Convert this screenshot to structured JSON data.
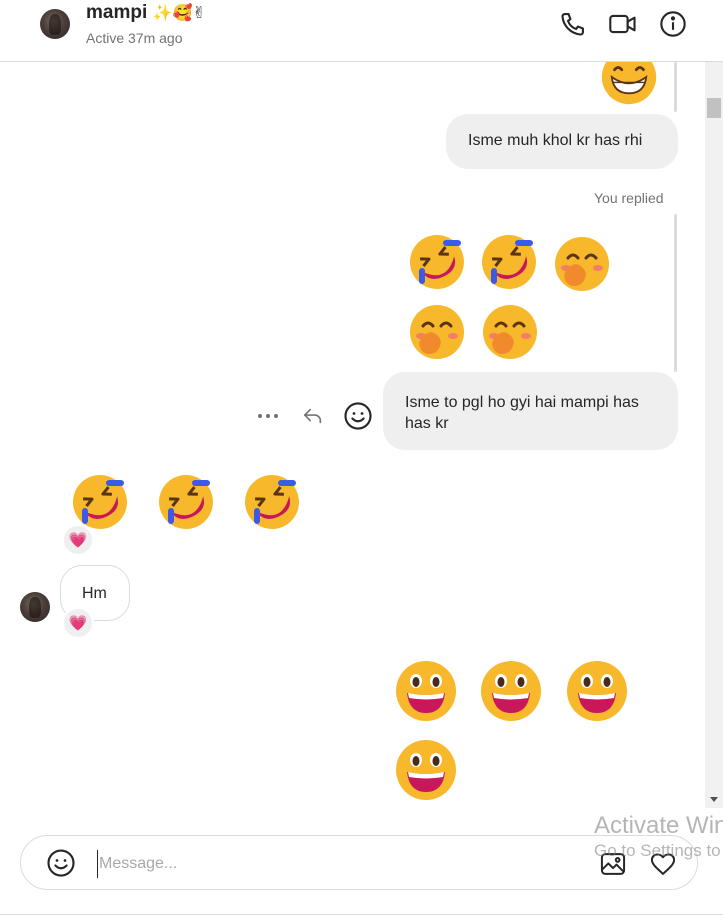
{
  "header": {
    "name": "mampi",
    "name_emojis": "✨🥰✌",
    "status": "Active 37m ago"
  },
  "messages": {
    "sent_text_1": "Isme muh khol kr has rhi",
    "reply_label": "You replied",
    "sent_text_2": "Isme to pgl ho gyi hai mampi has has kr",
    "received_text": "Hm"
  },
  "emoji_groups": {
    "top_partial": [
      "grinning-face"
    ],
    "replied_quote": [
      "rolling-on-floor-laughing",
      "rolling-on-floor-laughing",
      "face-with-hand-over-mouth",
      "face-with-hand-over-mouth",
      "face-with-hand-over-mouth"
    ],
    "received_laughing": [
      "rolling-on-floor-laughing",
      "rolling-on-floor-laughing",
      "rolling-on-floor-laughing"
    ],
    "sent_grinning": [
      "grinning-face-big-eyes",
      "grinning-face-big-eyes",
      "grinning-face-big-eyes",
      "grinning-face-big-eyes"
    ]
  },
  "reactions": [
    "💗",
    "💗"
  ],
  "composer": {
    "placeholder": "Message..."
  },
  "watermark": {
    "line1": "Activate Win",
    "line2": "Go to Settings to"
  },
  "colors": {
    "bubble": "#efefef",
    "border": "#dbdbdb",
    "secondary_text": "#737373",
    "emoji_yellow": "#f8b82c"
  }
}
